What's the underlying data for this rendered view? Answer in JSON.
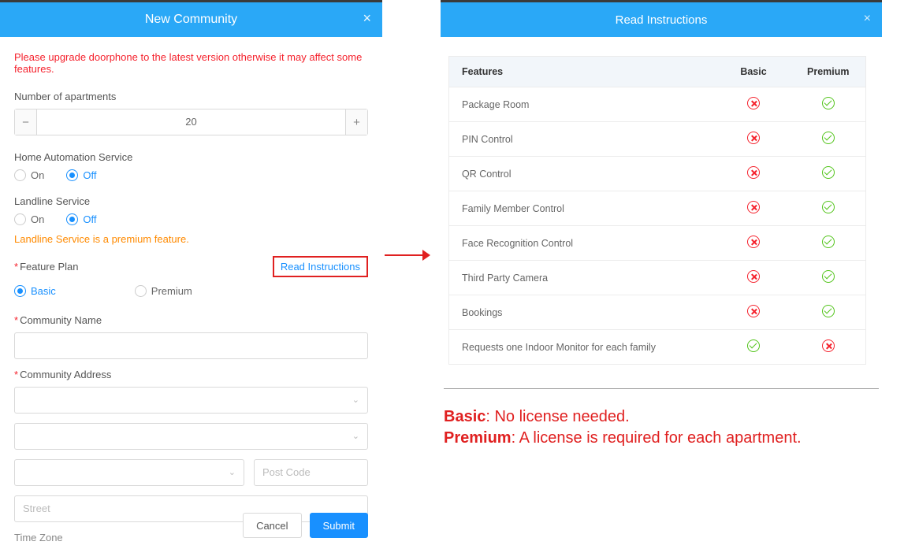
{
  "left": {
    "title": "New Community",
    "warning": "Please upgrade doorphone to the latest version otherwise it may affect some features.",
    "apartments_label": "Number of apartments",
    "apartments_value": "20",
    "home_auto_label": "Home Automation Service",
    "landline_label": "Landline Service",
    "radio_on": "On",
    "radio_off": "Off",
    "premium_note": "Landline Service is a premium feature.",
    "feature_plan_label": "Feature Plan",
    "read_instructions": "Read Instructions",
    "plan_basic": "Basic",
    "plan_premium": "Premium",
    "community_name_label": "Community Name",
    "community_addr_label": "Community Address",
    "postcode_placeholder": "Post Code",
    "street_placeholder": "Street",
    "timezone_label": "Time Zone",
    "cancel": "Cancel",
    "submit": "Submit"
  },
  "right": {
    "title": "Read Instructions",
    "th_features": "Features",
    "th_basic": "Basic",
    "th_premium": "Premium",
    "rows": [
      {
        "name": "Package Room",
        "basic": "x",
        "premium": "check"
      },
      {
        "name": "PIN Control",
        "basic": "x",
        "premium": "check"
      },
      {
        "name": "QR Control",
        "basic": "x",
        "premium": "check"
      },
      {
        "name": "Family Member Control",
        "basic": "x",
        "premium": "check"
      },
      {
        "name": "Face Recognition Control",
        "basic": "x",
        "premium": "check"
      },
      {
        "name": "Third Party Camera",
        "basic": "x",
        "premium": "check"
      },
      {
        "name": "Bookings",
        "basic": "x",
        "premium": "check"
      },
      {
        "name": "Requests one Indoor Monitor for each family",
        "basic": "check",
        "premium": "x"
      }
    ],
    "explain_basic_label": "Basic",
    "explain_basic_text": ": No license needed.",
    "explain_premium_label": "Premium",
    "explain_premium_text": ": A license is required for each apartment."
  }
}
